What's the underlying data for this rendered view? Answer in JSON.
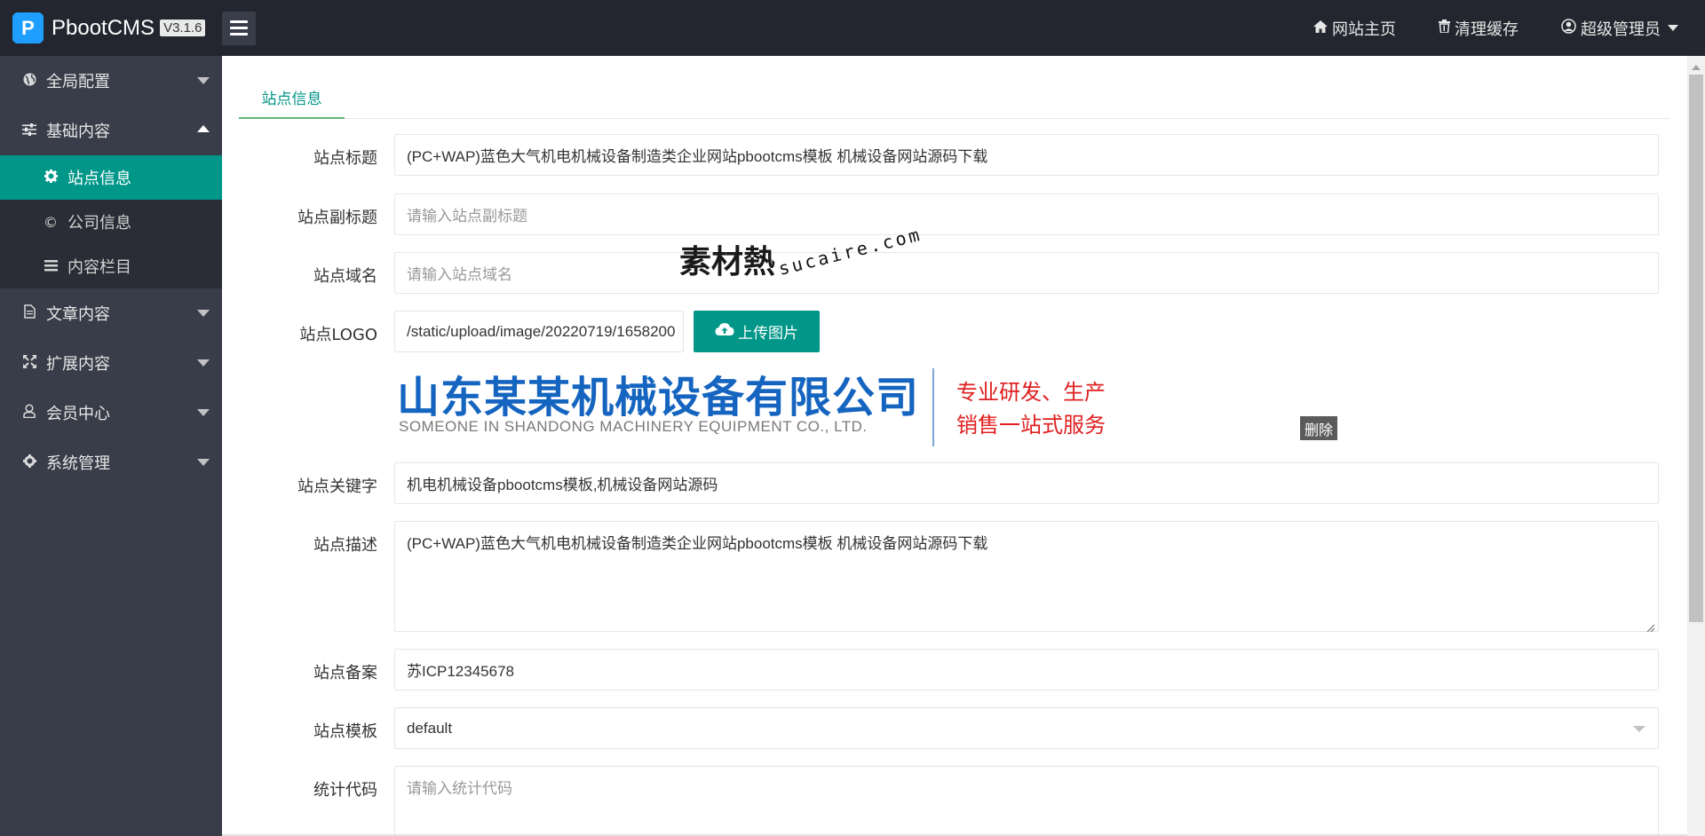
{
  "app": {
    "name": "PbootCMS",
    "version": "V3.1.6"
  },
  "header": {
    "home_label": "网站主页",
    "clear_cache_label": "清理缓存",
    "user_label": "超级管理员"
  },
  "sidebar": {
    "groups": [
      {
        "label": "全局配置",
        "icon": "globe-icon",
        "expanded": false
      },
      {
        "label": "基础内容",
        "icon": "sliders-icon",
        "expanded": true
      },
      {
        "label": "文章内容",
        "icon": "file-icon",
        "expanded": false
      },
      {
        "label": "扩展内容",
        "icon": "expand-icon",
        "expanded": false
      },
      {
        "label": "会员中心",
        "icon": "user-icon",
        "expanded": false
      },
      {
        "label": "系统管理",
        "icon": "gear-icon",
        "expanded": false
      }
    ],
    "sub_items": [
      {
        "label": "站点信息",
        "icon": "gear-icon",
        "active": true
      },
      {
        "label": "公司信息",
        "icon": "copyright-icon",
        "active": false
      },
      {
        "label": "内容栏目",
        "icon": "list-icon",
        "active": false
      }
    ]
  },
  "tabs": [
    {
      "label": "站点信息",
      "active": true
    }
  ],
  "form": {
    "title": {
      "label": "站点标题",
      "value": "(PC+WAP)蓝色大气机电机械设备制造类企业网站pbootcms模板 机械设备网站源码下载"
    },
    "subtitle": {
      "label": "站点副标题",
      "placeholder": "请输入站点副标题"
    },
    "domain": {
      "label": "站点域名",
      "placeholder": "请输入站点域名"
    },
    "logo": {
      "label": "站点LOGO",
      "value": "/static/upload/image/20220719/1658200",
      "upload_label": "上传图片",
      "delete_label": "删除"
    },
    "keywords": {
      "label": "站点关键字",
      "value": "机电机械设备pbootcms模板,机械设备网站源码"
    },
    "description": {
      "label": "站点描述",
      "value": "(PC+WAP)蓝色大气机电机械设备制造类企业网站pbootcms模板 机械设备网站源码下载"
    },
    "icp": {
      "label": "站点备案",
      "value": "苏ICP12345678"
    },
    "template": {
      "label": "站点模板",
      "value": "default"
    },
    "stats": {
      "label": "统计代码",
      "placeholder": "请输入统计代码"
    }
  },
  "logo_preview": {
    "company_cn": "山东某某机械设备有限公司",
    "company_en": "SOMEONE IN SHANDONG MACHINERY EQUIPMENT CO., LTD.",
    "slogan_line1": "专业研发、生产",
    "slogan_line2": "销售一站式服务"
  },
  "watermark": {
    "cn": "素材熱",
    "en": "sucaire.com"
  },
  "colors": {
    "header_bg": "#23262e",
    "sidebar_bg": "#393d49",
    "accent": "#009688",
    "logo_blue": "#1565c0",
    "slogan_red": "#e02020"
  }
}
